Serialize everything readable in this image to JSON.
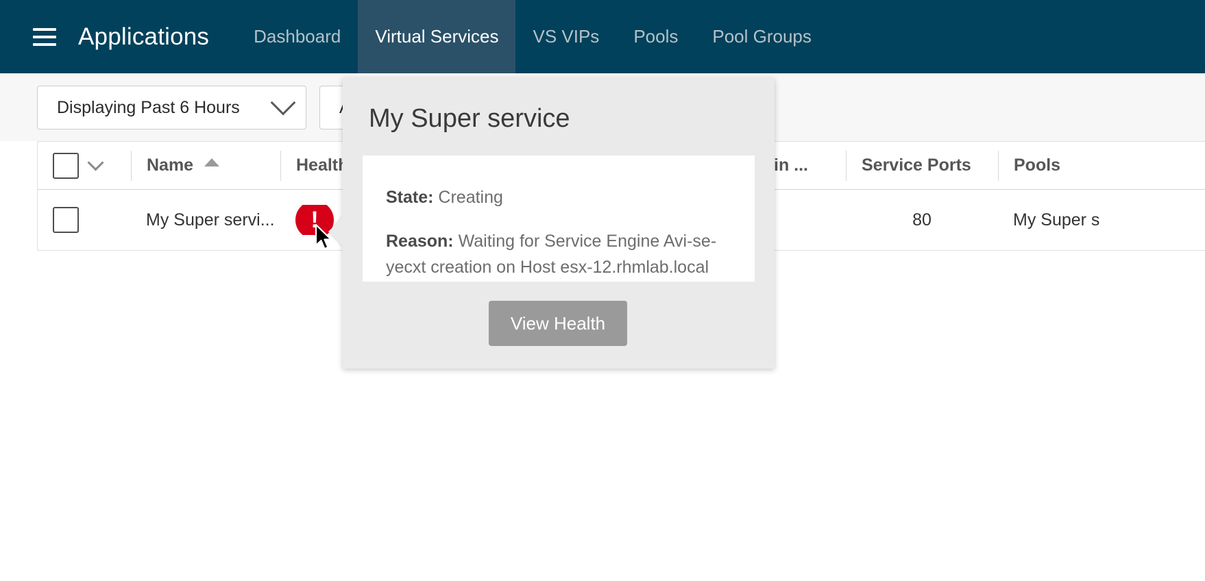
{
  "header": {
    "menu_icon": "hamburger-icon",
    "title": "Applications",
    "tabs": [
      {
        "label": "Dashboard",
        "active": false
      },
      {
        "label": "Virtual Services",
        "active": true
      },
      {
        "label": "VS VIPs",
        "active": false
      },
      {
        "label": "Pools",
        "active": false
      },
      {
        "label": "Pool Groups",
        "active": false
      }
    ],
    "background_color": "#02415b",
    "active_tab_color": "#2b5168"
  },
  "filters": {
    "time_range": {
      "label": "Displaying  Past 6 Hours",
      "icon": "chevron-down-icon"
    },
    "second_filter": {
      "label": "A"
    }
  },
  "table": {
    "select_all_icon": "checkbox-icon",
    "select_all_menu_icon": "chevron-down-icon",
    "columns": [
      {
        "label": "Name",
        "sort": "ascending",
        "sort_icon": "sort-ascending-icon"
      },
      {
        "label": "Health"
      },
      {
        "label": ""
      },
      {
        "label": "in ..."
      },
      {
        "label": "Service Ports"
      },
      {
        "label": "Pools"
      }
    ],
    "rows": [
      {
        "checkbox_icon": "checkbox-icon",
        "name": "My Super servi...",
        "health_icon": "error-exclamation-icon",
        "health_color": "#d60019",
        "health_glyph": "!",
        "mid": "",
        "vip": "",
        "service_ports": "80",
        "pools": "My Super s"
      }
    ]
  },
  "popover": {
    "title": "My Super service",
    "state_label": "State:",
    "state_value": "Creating",
    "reason_label": "Reason:",
    "reason_value": "Waiting for Service Engine Avi-se-yecxt creation on Host esx-12.rhmlab.local",
    "button_label": "View Health",
    "button_color": "#9a9a9a",
    "background_color": "#eaeaea"
  },
  "cursor": {
    "icon": "mouse-pointer-icon"
  }
}
